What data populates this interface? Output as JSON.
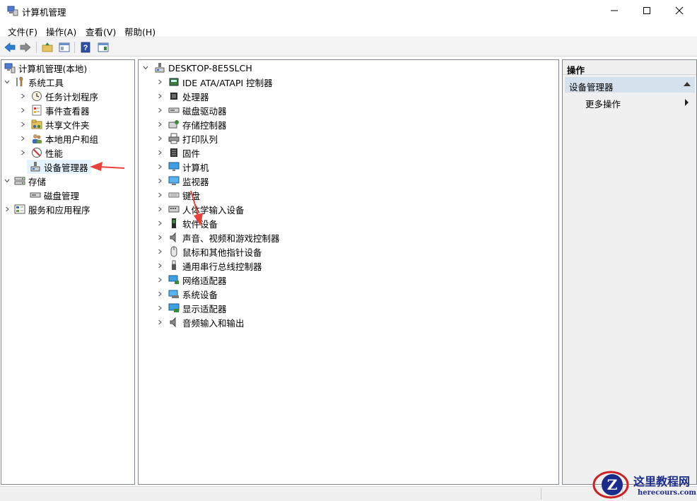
{
  "window": {
    "title": "计算机管理",
    "minimize": "minimize",
    "maximize": "maximize",
    "close": "close"
  },
  "menu": [
    "文件(F)",
    "操作(A)",
    "查看(V)",
    "帮助(H)"
  ],
  "toolbar": [
    "back-icon",
    "forward-icon",
    "folder-up-icon",
    "show-hide-tree-icon",
    "help-icon",
    "show-action-pane-icon"
  ],
  "left_tree": {
    "root": "计算机管理(本地)",
    "system_tools": "系统工具",
    "task_scheduler": "任务计划程序",
    "event_viewer": "事件查看器",
    "shared_folders": "共享文件夹",
    "local_users": "本地用户和组",
    "performance": "性能",
    "device_manager": "设备管理器",
    "storage": "存储",
    "disk_management": "磁盘管理",
    "services_apps": "服务和应用程序"
  },
  "device_tree": {
    "computer_name": "DESKTOP-8E5SLCH",
    "items": [
      {
        "label": "IDE ATA/ATAPI 控制器",
        "icon": "ide-controller-icon"
      },
      {
        "label": "处理器",
        "icon": "processor-icon"
      },
      {
        "label": "磁盘驱动器",
        "icon": "disk-drive-icon"
      },
      {
        "label": "存储控制器",
        "icon": "storage-controller-icon"
      },
      {
        "label": "打印队列",
        "icon": "printer-icon"
      },
      {
        "label": "固件",
        "icon": "firmware-icon"
      },
      {
        "label": "计算机",
        "icon": "computer-icon"
      },
      {
        "label": "监视器",
        "icon": "monitor-icon"
      },
      {
        "label": "键盘",
        "icon": "keyboard-icon"
      },
      {
        "label": "人体学输入设备",
        "icon": "hid-icon"
      },
      {
        "label": "软件设备",
        "icon": "software-device-icon"
      },
      {
        "label": "声音、视频和游戏控制器",
        "icon": "sound-icon"
      },
      {
        "label": "鼠标和其他指针设备",
        "icon": "mouse-icon"
      },
      {
        "label": "通用串行总线控制器",
        "icon": "usb-icon"
      },
      {
        "label": "网络适配器",
        "icon": "network-adapter-icon"
      },
      {
        "label": "系统设备",
        "icon": "system-device-icon"
      },
      {
        "label": "显示适配器",
        "icon": "display-adapter-icon"
      },
      {
        "label": "音频输入和输出",
        "icon": "audio-io-icon"
      }
    ]
  },
  "actions": {
    "title": "操作",
    "section": "设备管理器",
    "more": "更多操作"
  },
  "watermark": {
    "text": "这里教程网",
    "url": "herecours.com"
  },
  "colors": {
    "accent_arrow": "#e8413a",
    "selection": "#e5f3ff",
    "action_header": "#d5e1ed"
  }
}
